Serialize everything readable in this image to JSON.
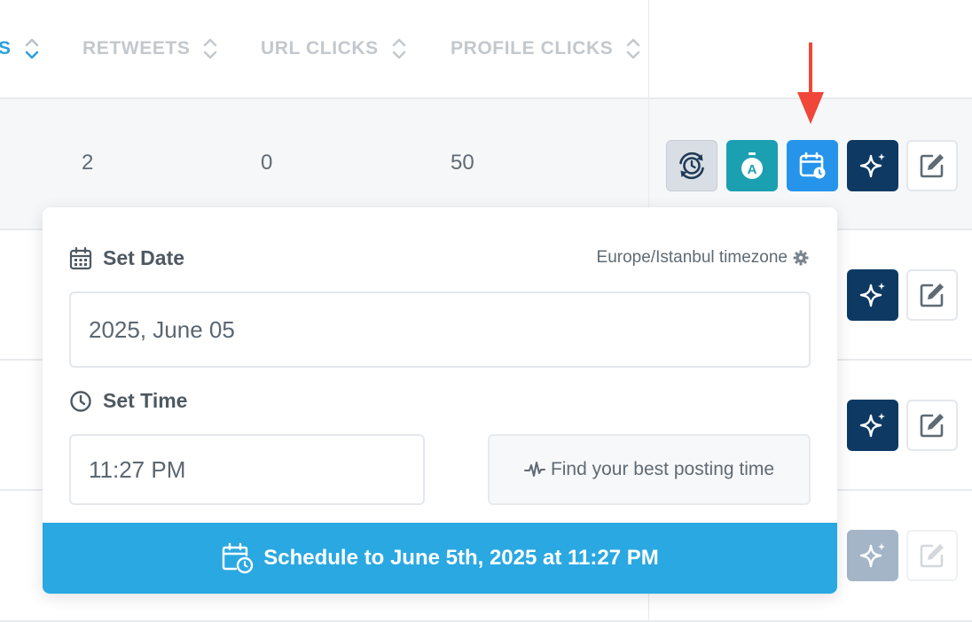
{
  "table": {
    "columns": [
      {
        "label": "S",
        "sort": "desc"
      },
      {
        "label": "RETWEETS"
      },
      {
        "label": "URL CLICKS"
      },
      {
        "label": "PROFILE CLICKS"
      }
    ],
    "rows": [
      {
        "retweets": "2",
        "url_clicks": "0",
        "profile_clicks": "50"
      }
    ]
  },
  "actions": {
    "recycle_icon": "recycle-clock-icon",
    "autoplug_icon": "stopwatch-a-icon",
    "schedule_icon": "calendar-clock-icon",
    "ai_icon": "sparkles-icon",
    "edit_icon": "edit-pencil-icon"
  },
  "popover": {
    "set_date_label": "Set Date",
    "timezone": "Europe/Istanbul timezone",
    "date_value": "2025, June 05",
    "set_time_label": "Set Time",
    "time_value": "11:27 PM",
    "best_time_label": "Find your best posting time",
    "schedule_button": "Schedule to June 5th, 2025 at 11:27 PM"
  },
  "colors": {
    "accent": "#2aa8e2",
    "ai_button": "#0d3963",
    "autoplug_button": "#1ba0b2",
    "schedule_icon_button": "#2594ea",
    "annotation_arrow": "#f0473a"
  }
}
